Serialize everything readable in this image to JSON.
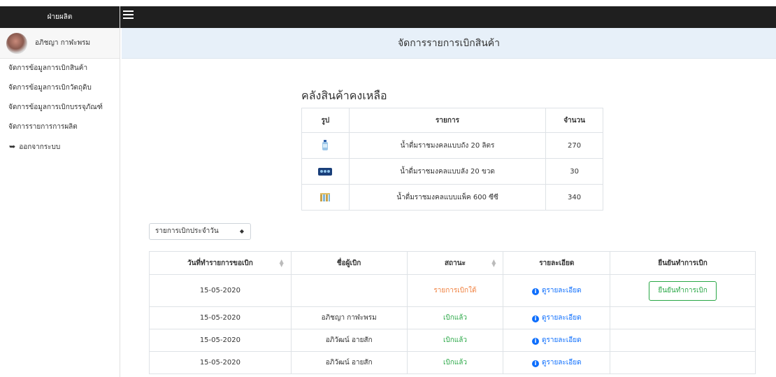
{
  "sidebar": {
    "header": "ฝ่ายผลิต",
    "user_name": "อภิชญา กาฬะพรม",
    "items": [
      {
        "label": "จัดการข้อมูลการเบิกสินค้า"
      },
      {
        "label": "จัดการข้อมูลการเบิกวัตถุดิบ"
      },
      {
        "label": "จัดการข้อมูลการเบิกบรรจุภัณฑ์"
      },
      {
        "label": "จัดการรายการการผลิต"
      }
    ],
    "logout": "ออกจากระบบ"
  },
  "page_title": "จัดการรายการเบิกสินค้า",
  "stock": {
    "title": "คลังสินค้าคงเหลือ",
    "headers": {
      "pic": "รูป",
      "item": "รายการ",
      "qty": "จำนวน"
    },
    "rows": [
      {
        "icon": "water-tank-icon",
        "item": "น้ำดื่มราชมงคลแบบถัง 20 ลิตร",
        "qty": "270"
      },
      {
        "icon": "bottle-crate-icon",
        "item": "น้ำดื่มราชมงคลแบบลัง 20 ขวด",
        "qty": "30"
      },
      {
        "icon": "bottle-pack-icon",
        "item": "น้ำดื่มราชมงคลแบบแพ็ค 600 ซีซี",
        "qty": "340"
      }
    ]
  },
  "filter": {
    "selected": "รายการเบิกประจำวัน"
  },
  "orders": {
    "headers": {
      "date": "วันที่ทำรายการขอเบิก",
      "name": "ชื่อผู้เบิก",
      "status": "สถานะ",
      "detail": "รายละเอียด",
      "confirm": "ยืนยันทำการเบิก"
    },
    "detail_label": "ดูรายละเอียด",
    "confirm_label": "ยืนยันทำการเบิก",
    "rows": [
      {
        "date": "15-05-2020",
        "name": "",
        "status": "รายการเบิกใต้",
        "status_color": "#f07f3c"
      },
      {
        "date": "15-05-2020",
        "name": "อภิชญา กาฬะพรม",
        "status": "เบิกแล้ว",
        "status_color": "#28a745"
      },
      {
        "date": "15-05-2020",
        "name": "อภิวัฒน์ อายสัก",
        "status": "เบิกแล้ว",
        "status_color": "#28a745"
      },
      {
        "date": "15-05-2020",
        "name": "อภิวัฒน์ อายสัก",
        "status": "เบิกแล้ว",
        "status_color": "#28a745"
      }
    ]
  },
  "colors": {
    "navbar": "#1f1f1f",
    "title_bar": "#e7f0f9",
    "pending": "#f07f3c",
    "done": "#28a745",
    "link": "#0d6efd"
  }
}
